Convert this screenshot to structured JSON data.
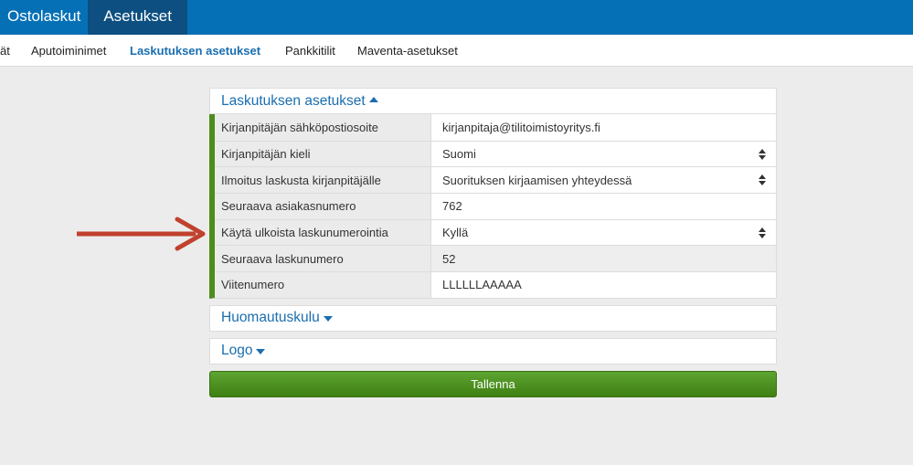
{
  "topnav": {
    "tabs": [
      {
        "label": "Ostolaskut"
      },
      {
        "label": "Asetukset"
      }
    ]
  },
  "subnav": {
    "items": [
      {
        "label": "ät"
      },
      {
        "label": "Aputoiminimet"
      },
      {
        "label": "Laskutuksen asetukset"
      },
      {
        "label": "Pankkitilit"
      },
      {
        "label": "Maventa-asetukset"
      }
    ]
  },
  "billing": {
    "title": "Laskutuksen asetukset",
    "rows": [
      {
        "label": "Kirjanpitäjän sähköpostiosoite",
        "value": "kirjanpitaja@tilitoimistoyritys.fi"
      },
      {
        "label": "Kirjanpitäjän kieli",
        "value": "Suomi"
      },
      {
        "label": "Ilmoitus laskusta kirjanpitäjälle",
        "value": "Suorituksen kirjaamisen yhteydessä"
      },
      {
        "label": "Seuraava asiakasnumero",
        "value": "762"
      },
      {
        "label": "Käytä ulkoista laskunumerointia",
        "value": "Kyllä"
      },
      {
        "label": "Seuraava laskunumero",
        "value": "52"
      },
      {
        "label": "Viitenumero",
        "value": "LLLLLLAAAAA"
      }
    ]
  },
  "reminder": {
    "title": "Huomautuskulu"
  },
  "logo": {
    "title": "Logo"
  },
  "save_button": {
    "label": "Tallenna"
  },
  "colors": {
    "topbar": "#0670b6",
    "topbar_active": "#0d4f80",
    "link_blue": "#1a6eb0",
    "accent_green": "#4c8d1c",
    "annotation_arrow": "#c0412d"
  }
}
